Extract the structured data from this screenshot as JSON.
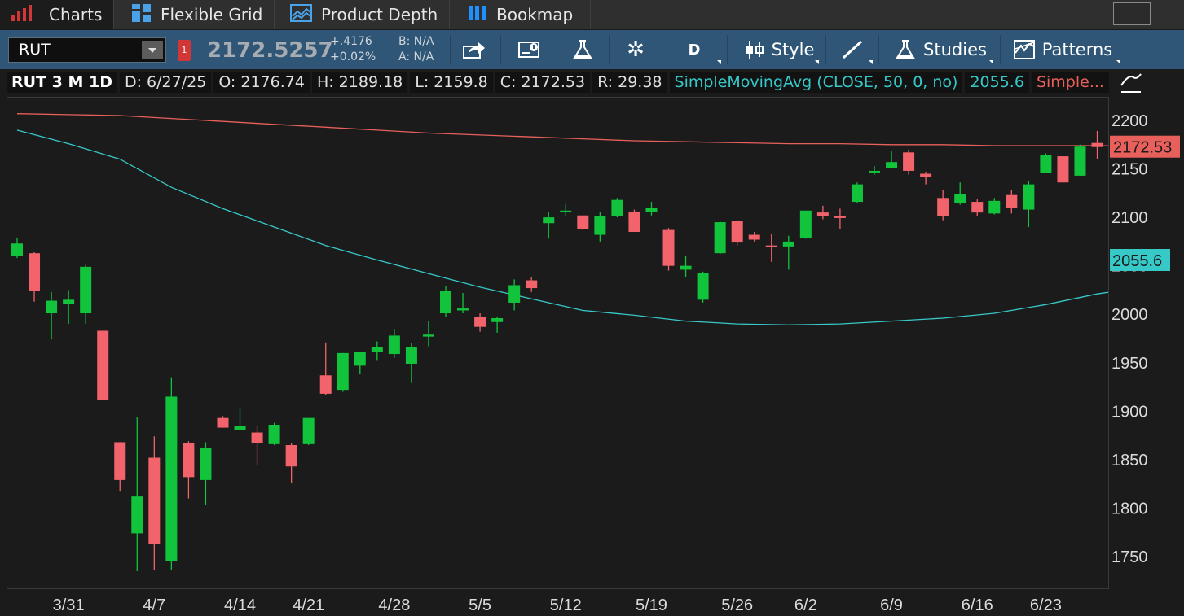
{
  "tabs": [
    {
      "label": "Charts",
      "icon": "bar-chart-icon",
      "active": true
    },
    {
      "label": "Flexible Grid",
      "icon": "grid-icon",
      "active": false
    },
    {
      "label": "Product Depth",
      "icon": "depth-icon",
      "active": false
    },
    {
      "label": "Bookmap",
      "icon": "bookmap-icon",
      "active": false
    }
  ],
  "toolbar": {
    "symbol": "RUT",
    "price": "2172.5257",
    "change": "+.4176",
    "change_pct": "+0.02%",
    "bid": "B: N/A",
    "ask": "A: N/A",
    "aggregation": "D",
    "style_label": "Style",
    "studies_label": "Studies",
    "patterns_label": "Patterns"
  },
  "infobar": {
    "title": "RUT 3 M 1D",
    "date": "D: 6/27/25",
    "open": "O: 2176.74",
    "high": "H: 2189.18",
    "low": "L: 2159.8",
    "close": "C: 2172.53",
    "range": "R: 29.38",
    "study1": "SimpleMovingAvg (CLOSE, 50, 0, no)",
    "study1_value": "2055.6",
    "study2": "Simple..."
  },
  "colors": {
    "up": "#12c43c",
    "down": "#f2636b",
    "sma50": "#37c8c8",
    "sma200": "#e8605c",
    "background": "#1b1b1b"
  },
  "chart_data": {
    "type": "candlestick",
    "ylim": [
      1720,
      2220
    ],
    "yticks": [
      1750,
      1800,
      1850,
      1900,
      1950,
      2000,
      2050,
      2100,
      2150,
      2200
    ],
    "xtick_labels": [
      {
        "label": "3/31",
        "index": 3
      },
      {
        "label": "4/7",
        "index": 8
      },
      {
        "label": "4/14",
        "index": 13
      },
      {
        "label": "4/21",
        "index": 17
      },
      {
        "label": "4/28",
        "index": 22
      },
      {
        "label": "5/5",
        "index": 27
      },
      {
        "label": "5/12",
        "index": 32
      },
      {
        "label": "5/19",
        "index": 37
      },
      {
        "label": "5/26",
        "index": 42
      },
      {
        "label": "6/2",
        "index": 46
      },
      {
        "label": "6/9",
        "index": 51
      },
      {
        "label": "6/16",
        "index": 56
      },
      {
        "label": "6/23",
        "index": 60
      }
    ],
    "price_label": "2172.53",
    "sma50_label": "2055.6",
    "candles": [
      {
        "o": 2060,
        "h": 2079,
        "l": 2058,
        "c": 2073
      },
      {
        "o": 2063,
        "h": 2064,
        "l": 2013,
        "c": 2024
      },
      {
        "o": 2001,
        "h": 2023,
        "l": 1974,
        "c": 2014
      },
      {
        "o": 2011,
        "h": 2025,
        "l": 1990,
        "c": 2015
      },
      {
        "o": 2001,
        "h": 2051,
        "l": 1990,
        "c": 2049
      },
      {
        "o": 1983,
        "h": 1983,
        "l": 1912,
        "c": 1912
      },
      {
        "o": 1868,
        "h": 1868,
        "l": 1817,
        "c": 1829
      },
      {
        "o": 1774,
        "h": 1894,
        "l": 1735,
        "c": 1812
      },
      {
        "o": 1852,
        "h": 1874,
        "l": 1736,
        "c": 1763
      },
      {
        "o": 1745,
        "h": 1935,
        "l": 1736,
        "c": 1915
      },
      {
        "o": 1867,
        "h": 1869,
        "l": 1810,
        "c": 1832
      },
      {
        "o": 1829,
        "h": 1868,
        "l": 1803,
        "c": 1862
      },
      {
        "o": 1893,
        "h": 1895,
        "l": 1883,
        "c": 1883
      },
      {
        "o": 1881,
        "h": 1904,
        "l": 1880,
        "c": 1885
      },
      {
        "o": 1878,
        "h": 1885,
        "l": 1845,
        "c": 1867
      },
      {
        "o": 1866,
        "h": 1888,
        "l": 1865,
        "c": 1886
      },
      {
        "o": 1865,
        "h": 1867,
        "l": 1826,
        "c": 1843
      },
      {
        "o": 1866,
        "h": 1893,
        "l": 1865,
        "c": 1893
      },
      {
        "o": 1937,
        "h": 1971,
        "l": 1917,
        "c": 1918
      },
      {
        "o": 1922,
        "h": 1960,
        "l": 1920,
        "c": 1960
      },
      {
        "o": 1947,
        "h": 1961,
        "l": 1938,
        "c": 1961
      },
      {
        "o": 1961,
        "h": 1972,
        "l": 1952,
        "c": 1966
      },
      {
        "o": 1959,
        "h": 1985,
        "l": 1955,
        "c": 1978
      },
      {
        "o": 1949,
        "h": 1970,
        "l": 1929,
        "c": 1966
      },
      {
        "o": 1977,
        "h": 1993,
        "l": 1967,
        "c": 1979
      },
      {
        "o": 2001,
        "h": 2029,
        "l": 1997,
        "c": 2024
      },
      {
        "o": 2004,
        "h": 2022,
        "l": 2001,
        "c": 2006
      },
      {
        "o": 1997,
        "h": 2001,
        "l": 1982,
        "c": 1987
      },
      {
        "o": 1992,
        "h": 1997,
        "l": 1981,
        "c": 1996
      },
      {
        "o": 2012,
        "h": 2036,
        "l": 2004,
        "c": 2030
      },
      {
        "o": 2035,
        "h": 2038,
        "l": 2023,
        "c": 2027
      },
      {
        "o": 2094,
        "h": 2105,
        "l": 2078,
        "c": 2100
      },
      {
        "o": 2107,
        "h": 2114,
        "l": 2101,
        "c": 2107
      },
      {
        "o": 2102,
        "h": 2102,
        "l": 2087,
        "c": 2088
      },
      {
        "o": 2082,
        "h": 2105,
        "l": 2075,
        "c": 2101
      },
      {
        "o": 2101,
        "h": 2120,
        "l": 2100,
        "c": 2118
      },
      {
        "o": 2106,
        "h": 2108,
        "l": 2085,
        "c": 2085
      },
      {
        "o": 2106,
        "h": 2116,
        "l": 2102,
        "c": 2110
      },
      {
        "o": 2087,
        "h": 2089,
        "l": 2045,
        "c": 2050
      },
      {
        "o": 2046,
        "h": 2060,
        "l": 2038,
        "c": 2050
      },
      {
        "o": 2015,
        "h": 2044,
        "l": 2012,
        "c": 2043
      },
      {
        "o": 2063,
        "h": 2096,
        "l": 2062,
        "c": 2095
      },
      {
        "o": 2096,
        "h": 2097,
        "l": 2071,
        "c": 2074
      },
      {
        "o": 2082,
        "h": 2085,
        "l": 2075,
        "c": 2077
      },
      {
        "o": 2071,
        "h": 2083,
        "l": 2054,
        "c": 2070
      },
      {
        "o": 2070,
        "h": 2081,
        "l": 2046,
        "c": 2075
      },
      {
        "o": 2079,
        "h": 2107,
        "l": 2078,
        "c": 2107
      },
      {
        "o": 2105,
        "h": 2112,
        "l": 2098,
        "c": 2101
      },
      {
        "o": 2101,
        "h": 2109,
        "l": 2088,
        "c": 2100
      },
      {
        "o": 2116,
        "h": 2136,
        "l": 2115,
        "c": 2134
      },
      {
        "o": 2147,
        "h": 2153,
        "l": 2144,
        "c": 2148
      },
      {
        "o": 2151,
        "h": 2168,
        "l": 2151,
        "c": 2157
      },
      {
        "o": 2167,
        "h": 2170,
        "l": 2144,
        "c": 2148
      },
      {
        "o": 2145,
        "h": 2147,
        "l": 2134,
        "c": 2142
      },
      {
        "o": 2120,
        "h": 2128,
        "l": 2097,
        "c": 2101
      },
      {
        "o": 2115,
        "h": 2136,
        "l": 2113,
        "c": 2124
      },
      {
        "o": 2116,
        "h": 2119,
        "l": 2101,
        "c": 2105
      },
      {
        "o": 2104,
        "h": 2120,
        "l": 2103,
        "c": 2117
      },
      {
        "o": 2123,
        "h": 2128,
        "l": 2104,
        "c": 2110
      },
      {
        "o": 2108,
        "h": 2137,
        "l": 2090,
        "c": 2134
      },
      {
        "o": 2146,
        "h": 2166,
        "l": 2146,
        "c": 2164
      },
      {
        "o": 2163,
        "h": 2163,
        "l": 2136,
        "c": 2136
      },
      {
        "o": 2143,
        "h": 2175,
        "l": 2143,
        "c": 2173
      },
      {
        "o": 2176.74,
        "h": 2189.18,
        "l": 2159.8,
        "c": 2172.53
      }
    ],
    "sma50": [
      [
        0,
        2190
      ],
      [
        3,
        2176
      ],
      [
        6,
        2160
      ],
      [
        9,
        2131
      ],
      [
        12,
        2109
      ],
      [
        15,
        2090
      ],
      [
        18,
        2071
      ],
      [
        21,
        2056
      ],
      [
        24,
        2042
      ],
      [
        27,
        2028
      ],
      [
        30,
        2016
      ],
      [
        33,
        2004
      ],
      [
        36,
        1999
      ],
      [
        39,
        1993
      ],
      [
        42,
        1990
      ],
      [
        45,
        1989
      ],
      [
        48,
        1990
      ],
      [
        51,
        1993
      ],
      [
        54,
        1996
      ],
      [
        57,
        2001
      ],
      [
        60,
        2010
      ],
      [
        63,
        2021
      ],
      [
        66,
        2029
      ],
      [
        69,
        2040
      ],
      [
        72,
        2048
      ],
      [
        75,
        2055.6
      ]
    ],
    "sma200": [
      [
        0,
        2207
      ],
      [
        3,
        2206
      ],
      [
        6,
        2205
      ],
      [
        9,
        2202
      ],
      [
        12,
        2199
      ],
      [
        15,
        2196
      ],
      [
        18,
        2193
      ],
      [
        21,
        2190
      ],
      [
        24,
        2187
      ],
      [
        27,
        2185
      ],
      [
        30,
        2183
      ],
      [
        33,
        2181
      ],
      [
        36,
        2179
      ],
      [
        39,
        2178
      ],
      [
        42,
        2177
      ],
      [
        45,
        2176
      ],
      [
        48,
        2176
      ],
      [
        51,
        2175
      ],
      [
        54,
        2175
      ],
      [
        57,
        2174
      ],
      [
        60,
        2174
      ],
      [
        63,
        2174
      ],
      [
        66,
        2173.5
      ],
      [
        69,
        2173
      ],
      [
        72,
        2173
      ],
      [
        75,
        2173
      ]
    ]
  }
}
